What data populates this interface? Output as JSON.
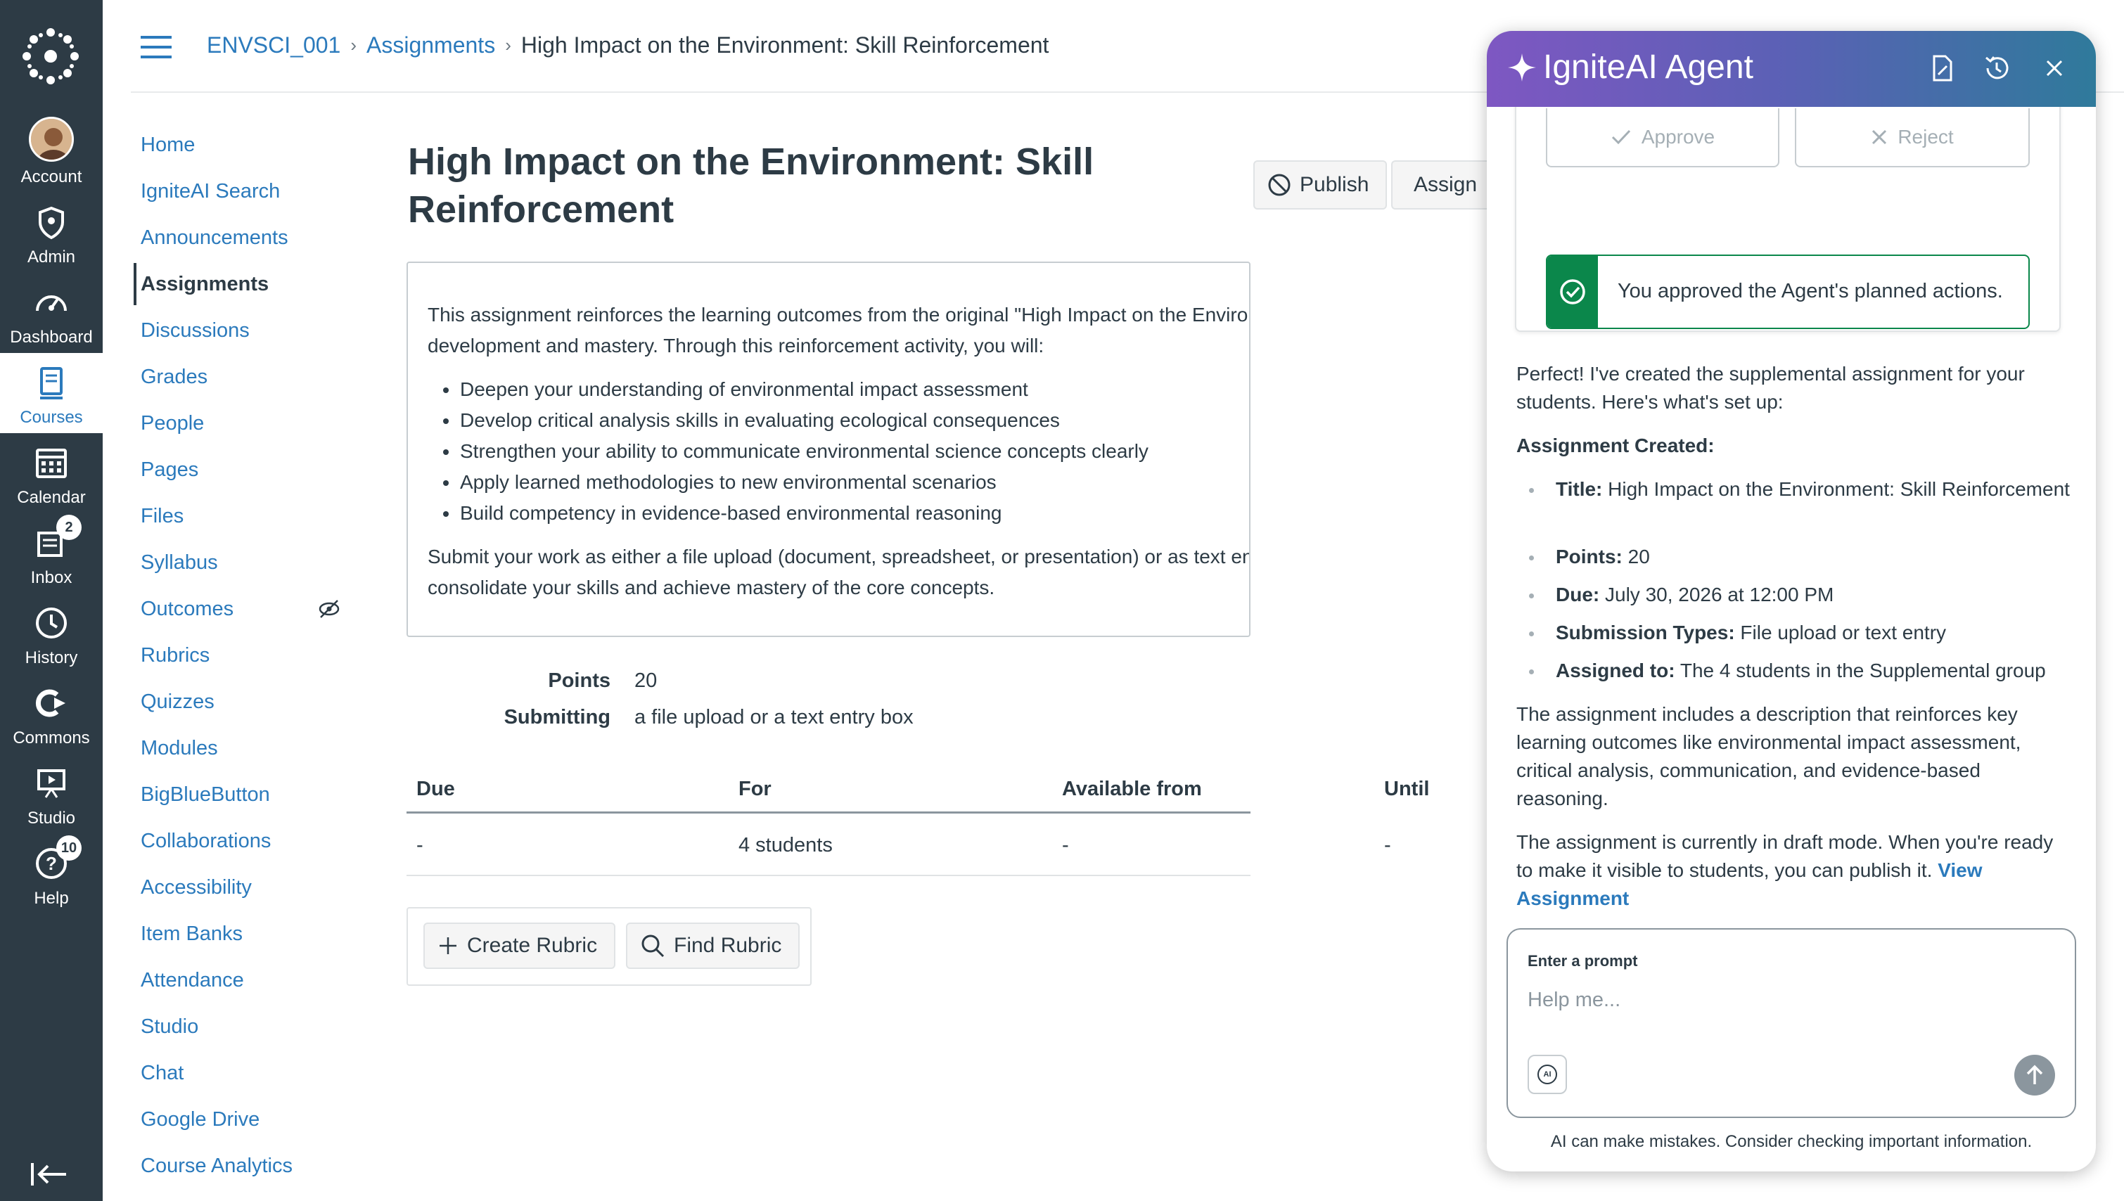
{
  "global_nav": {
    "items": [
      {
        "label": "Account"
      },
      {
        "label": "Admin"
      },
      {
        "label": "Dashboard"
      },
      {
        "label": "Courses"
      },
      {
        "label": "Calendar"
      },
      {
        "label": "Inbox",
        "badge": "2"
      },
      {
        "label": "History"
      },
      {
        "label": "Commons"
      },
      {
        "label": "Studio"
      },
      {
        "label": "Help",
        "badge": "10"
      }
    ],
    "active_color": "#2b7abc",
    "background": "#2d3b45"
  },
  "breadcrumb": {
    "course": "ENVSCI_001",
    "section": "Assignments",
    "current": "High Impact on the Environment: Skill Reinforcement",
    "separator": "›"
  },
  "course_nav": {
    "items": [
      {
        "label": "Home"
      },
      {
        "label": "IgniteAI Search"
      },
      {
        "label": "Announcements"
      },
      {
        "label": "Assignments"
      },
      {
        "label": "Discussions"
      },
      {
        "label": "Grades"
      },
      {
        "label": "People"
      },
      {
        "label": "Pages"
      },
      {
        "label": "Files"
      },
      {
        "label": "Syllabus"
      },
      {
        "label": "Outcomes"
      },
      {
        "label": "Rubrics"
      },
      {
        "label": "Quizzes"
      },
      {
        "label": "Modules"
      },
      {
        "label": "BigBlueButton"
      },
      {
        "label": "Collaborations"
      },
      {
        "label": "Accessibility"
      },
      {
        "label": "Item Banks"
      },
      {
        "label": "Attendance"
      },
      {
        "label": "Studio"
      },
      {
        "label": "Chat"
      },
      {
        "label": "Google Drive"
      },
      {
        "label": "Course Analytics"
      }
    ],
    "active": "Assignments"
  },
  "assignment": {
    "title": "High Impact on the Environment: Skill Reinforcement",
    "publish_label": "Publish",
    "assign_label": "Assign",
    "description": {
      "intro_line1": "This assignment reinforces the learning outcomes from the original \"High Impact on the Environment\" assignment, with",
      "intro_line2": "development and mastery. Through this reinforcement activity, you will:",
      "bullets": [
        "Deepen your understanding of environmental impact assessment",
        "Develop critical analysis skills in evaluating ecological consequences",
        "Strengthen your ability to communicate environmental science concepts clearly",
        "Apply learned methodologies to new environmental scenarios",
        "Build competency in evidence-based environmental reasoning"
      ],
      "outro_line1": "Submit your work as either a file upload (document, spreadsheet, or presentation) or as text entry. This assignment is des",
      "outro_line2": "consolidate your skills and achieve mastery of the core concepts."
    },
    "points_label": "Points",
    "points_value": "20",
    "submitting_label": "Submitting",
    "submitting_value": "a file upload or a text entry box",
    "table": {
      "headers": [
        "Due",
        "For",
        "Available from",
        "Until"
      ],
      "row": [
        "-",
        "4 students",
        "-",
        "-"
      ]
    },
    "create_rubric_label": "Create Rubric",
    "find_rubric_label": "Find Rubric"
  },
  "ai_panel": {
    "title": "IgniteAI Agent",
    "approve_label": "Approve",
    "reject_label": "Reject",
    "approved_message": "You approved the Agent's planned actions.",
    "response_intro": "Perfect! I've created the supplemental assignment for your students. Here's what's set up:",
    "created_heading": "Assignment Created:",
    "details": [
      {
        "key": "Title:",
        "value": "High Impact on the Environment: Skill Reinforcement"
      },
      {
        "key": "Points:",
        "value": "20"
      },
      {
        "key": "Due:",
        "value": "July 30, 2026 at 12:00 PM"
      },
      {
        "key": "Submission Types:",
        "value": "File upload or text entry"
      },
      {
        "key": "Assigned to:",
        "value": "The 4 students in the Supplemental group"
      }
    ],
    "summary": "The assignment includes a description that reinforces key learning outcomes like environmental impact assessment, critical analysis, communication, and evidence-based reasoning.",
    "draft_note": "The assignment is currently in draft mode. When you're ready to make it visible to students, you can publish it.",
    "view_link": "View Assignment",
    "prompt_label": "Enter a prompt",
    "prompt_placeholder": "Help me...",
    "prompt_value": "",
    "ai_chip_text": "AI",
    "disclaimer": "AI can make mistakes. Consider checking important information.",
    "header_gradient": [
      "#7e57c2",
      "#2f7a9b"
    ],
    "success_color": "#0b874b"
  }
}
